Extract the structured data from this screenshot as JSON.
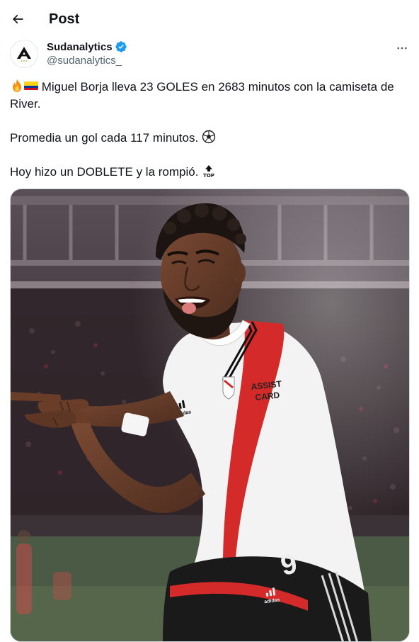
{
  "header": {
    "back_icon": "arrow-left-icon",
    "title": "Post"
  },
  "author": {
    "display_name": "Sudanalytics",
    "handle": "@sudanalytics_",
    "verified": true,
    "verified_color": "#1d9bf0",
    "avatar_icon": "sudanalytics-logo-icon"
  },
  "more_icon": "more-dots-icon",
  "tweet": {
    "line1_emojis": [
      "fire-emoji",
      "colombia-flag-emoji"
    ],
    "line1": "Miguel Borja lleva 23 GOLES en 2683 minutos con la camiseta de River.",
    "line2": "Promedia un gol cada 117 minutos.",
    "line2_emoji": "soccer-ball-emoji",
    "line3": "Hoy hizo un DOBLETE y la rompió.",
    "line3_emoji": "top-arrow-emoji"
  },
  "media": {
    "kind": "photo",
    "shirt_sponsor": "ASSIST CARD",
    "shirt_number": "9",
    "kit_brand": "adidas",
    "colors": {
      "shirt": "#f4f4f4",
      "sash": "#d92b2b",
      "shorts": "#1a1a1a",
      "stadium": "#3b2f34"
    }
  },
  "colors": {
    "text": "#0f1419",
    "secondary_text": "#536471",
    "border": "#cfd9de"
  }
}
